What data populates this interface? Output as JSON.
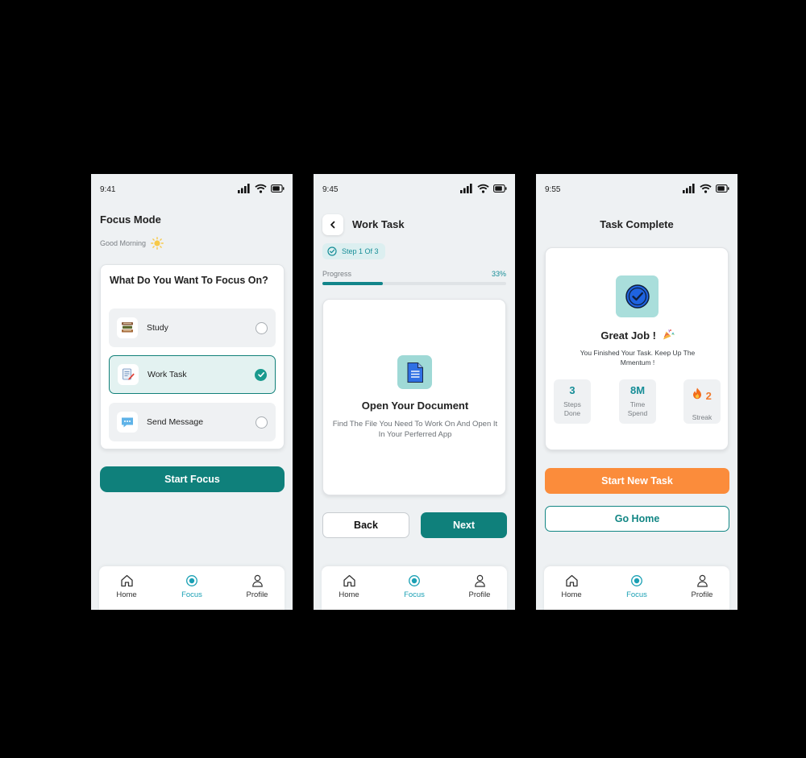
{
  "screens": [
    {
      "time": "9:41",
      "title": "Focus Mode",
      "greeting": "Good Morning",
      "question": "What Do You Want To Focus On?",
      "options": [
        {
          "label": "Study",
          "icon": "books-icon",
          "selected": false
        },
        {
          "label": "Work Task",
          "icon": "notepad-pen-icon",
          "selected": true
        },
        {
          "label": "Send Message",
          "icon": "chat-bubble-icon",
          "selected": false
        }
      ],
      "primary_button": "Start Focus"
    },
    {
      "time": "9:45",
      "title": "Work Task",
      "step_badge": "Step 1 Of 3",
      "progress_label": "Progress",
      "progress_text": "33%",
      "progress": 0.33,
      "card_title": "Open Your Document",
      "card_desc": "Find The File You Need To Work On And Open It In Your Perferred App",
      "back_button": "Back",
      "next_button": "Next"
    },
    {
      "time": "9:55",
      "title": "Task Complete",
      "card_title": "Great Job !",
      "card_desc": "You Finished Your Task. Keep Up The Mmentum !",
      "stats": [
        {
          "value": "3",
          "label": "Steps Done"
        },
        {
          "value": "8M",
          "label": "Time Spend"
        },
        {
          "value": "2",
          "label": "Streak"
        }
      ],
      "primary_button": "Start New Task",
      "secondary_button": "Go Home"
    }
  ],
  "nav": {
    "home": "Home",
    "focus": "Focus",
    "profile": "Profile",
    "active": "focus"
  },
  "colors": {
    "teal": "#0f807b",
    "accent": "#1aa0b4",
    "orange": "#fb8c3b",
    "background": "#eef1f3"
  }
}
